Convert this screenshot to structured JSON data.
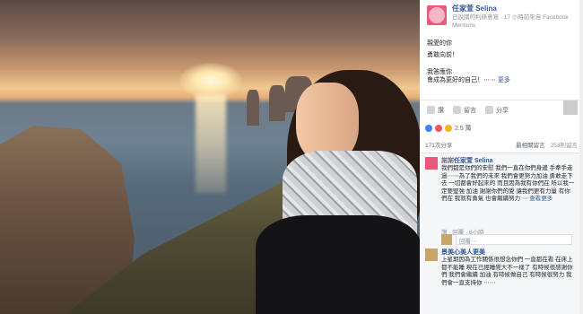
{
  "post": {
    "author": "任家萱 Selina",
    "author_sub": "已說國的利條意寫 · 17 小時前來自 Facebook Mentions",
    "body": [
      "親愛的你",
      "勇敢向前！",
      "我答應你",
      "會成為更好的自己！⋯⋯"
    ],
    "more_label": "更多"
  },
  "actions": {
    "like": "讚",
    "comment": "留言",
    "share": "分享"
  },
  "reactions": {
    "count": "2.5 萬"
  },
  "stats": {
    "shares": "171次分享",
    "sort": "最相關留言",
    "comments": "253則留言"
  },
  "comment1": {
    "author": "任家萱 Selina",
    "prefix": "謝謝",
    "text": "我們都是你們的安慰 我們一直在你們身邊 手牽手走過⋯⋯為了我們的未來 我們會更努力加油 勇敢走下去 一切都會好起來的 而且因為我有你們在 所以我一定要堅強 加油 謝謝你們的愛 讓我們更有力量 有你們在 我就有勇氣 也會繼續努力 ⋯",
    "see_more": "查看更多",
    "meta": "讚 · 回覆 · 6小時"
  },
  "reply": {
    "placeholder": "回覆⋯"
  },
  "comment2": {
    "author": "",
    "name": "景美心美人更美",
    "text": "上星期因為工作關係很想念你們 一直都在看 在床上都不能睡 現在已經睡覺大不一樣了 有時候很感謝你們 我們會繼續 加油 有時候做自己 有時候很努力 我們會一直支持你 ⋯⋯"
  },
  "colors": {
    "brand": "#365899",
    "like_blue": "#4080ff",
    "love_red": "#f25268",
    "wow_yellow": "#f7b125"
  }
}
